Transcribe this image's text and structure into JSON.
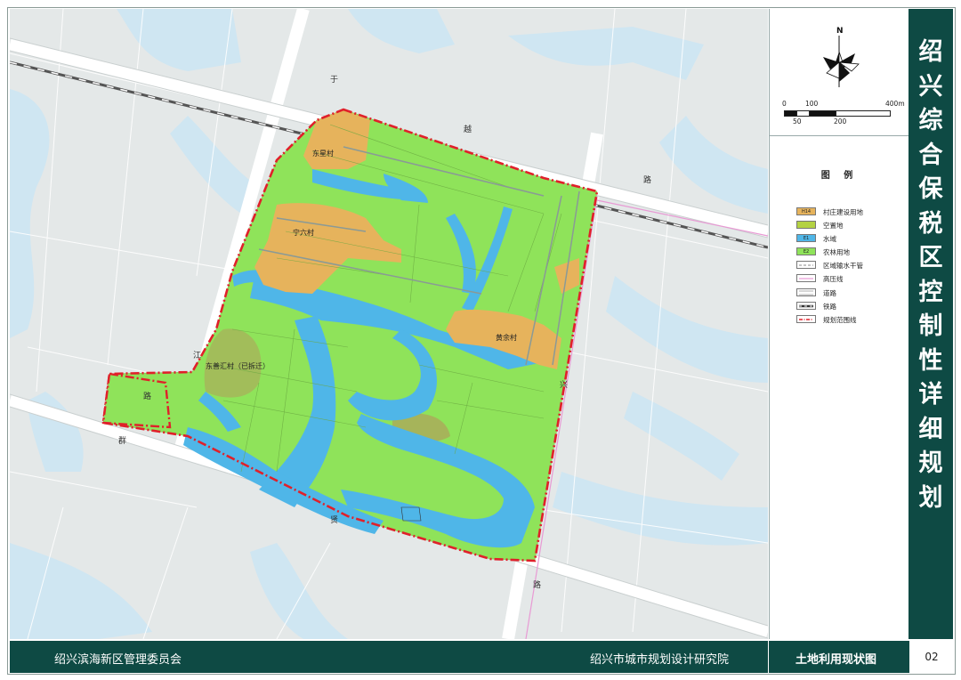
{
  "title": "绍兴综合保税区控制性详细规划",
  "title_chars": [
    "绍",
    "兴",
    "综",
    "合",
    "保",
    "税",
    "区",
    "控",
    "制",
    "性",
    "详",
    "细",
    "规",
    "划"
  ],
  "compass": {
    "north_label": "N"
  },
  "scale": {
    "top_labels": [
      "0",
      "100",
      "400m"
    ],
    "bottom_labels": [
      "50",
      "200"
    ]
  },
  "legend": {
    "title": "图  例",
    "items": [
      {
        "label": "村庄建设用地",
        "code": "H14",
        "color": "#e6b35c",
        "icon": "swatch-village"
      },
      {
        "label": "空置地",
        "code": "",
        "color": "#b4d243",
        "icon": "swatch-vacant"
      },
      {
        "label": "水域",
        "code": "E1",
        "color": "#4fb6e8",
        "icon": "swatch-water"
      },
      {
        "label": "农林用地",
        "code": "E2",
        "color": "#8fe35a",
        "icon": "swatch-farmland"
      },
      {
        "label": "区域输水干管",
        "code": "",
        "color": "#ffffff",
        "icon": "swatch-pipe"
      },
      {
        "label": "高压线",
        "code": "",
        "color": "#ffffff",
        "icon": "swatch-powerline"
      },
      {
        "label": "道路",
        "code": "",
        "color": "#ffffff",
        "icon": "swatch-road"
      },
      {
        "label": "铁路",
        "code": "",
        "color": "#ffffff",
        "icon": "swatch-railway"
      },
      {
        "label": "规划范围线",
        "code": "",
        "color": "#ffffff",
        "icon": "swatch-boundary"
      }
    ]
  },
  "map_labels": {
    "village_1": "东星村",
    "village_2": "宁六村",
    "village_3": "黄余村",
    "village_4": "东善汇村（已拆迁）"
  },
  "road_chars": [
    "于",
    "越",
    "路",
    "兴",
    "群",
    "贤",
    "路",
    "路",
    "江"
  ],
  "footer": {
    "left": "绍兴滨海新区管理委员会",
    "center": "绍兴市城市规划设计研究院",
    "right": "土地利用现状图",
    "page": "02"
  },
  "colors": {
    "frame_dark": "#0e4a44",
    "water": "#4fb6e8",
    "farmland": "#8fe35a",
    "village": "#e6b35c",
    "boundary": "#e0202a"
  }
}
